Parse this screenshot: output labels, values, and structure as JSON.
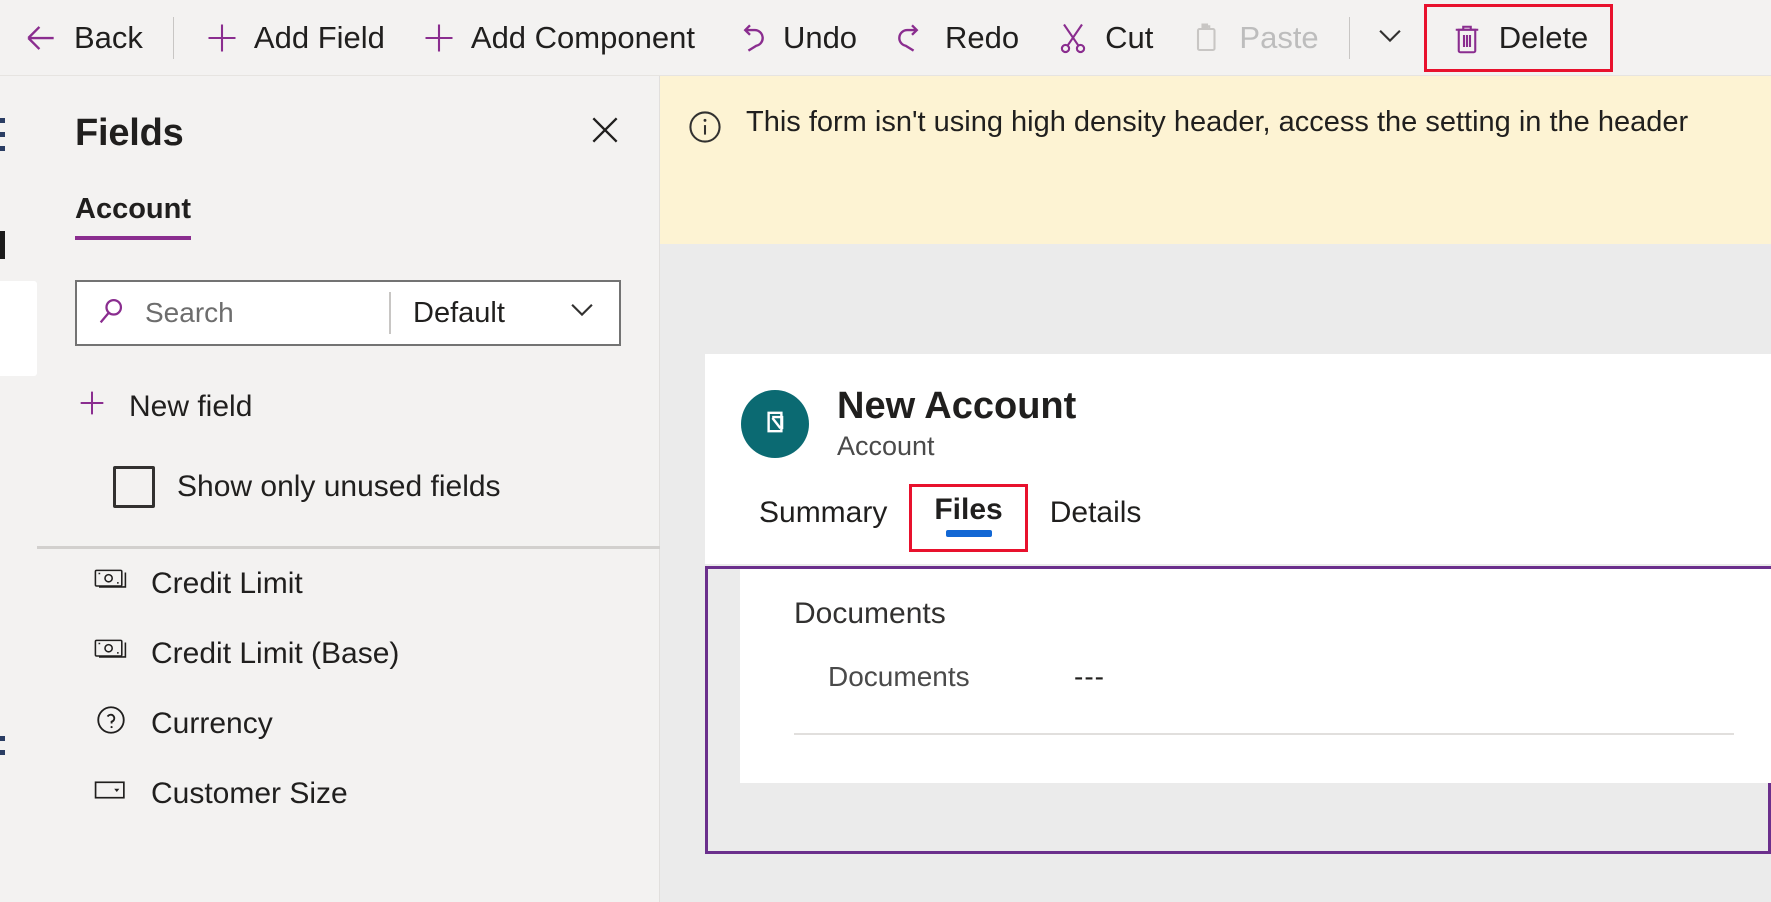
{
  "commandbar": {
    "buttons": [
      {
        "label": "Back",
        "icon": "arrow-left-icon",
        "disabled": false
      },
      {
        "label": "Add Field",
        "icon": "plus-icon",
        "disabled": false
      },
      {
        "label": "Add Component",
        "icon": "plus-icon",
        "disabled": false
      },
      {
        "label": "Undo",
        "icon": "undo-icon",
        "disabled": false
      },
      {
        "label": "Redo",
        "icon": "redo-icon",
        "disabled": false
      },
      {
        "label": "Cut",
        "icon": "scissors-icon",
        "disabled": false
      },
      {
        "label": "Paste",
        "icon": "clipboard-icon",
        "disabled": true
      },
      {
        "label": "Delete",
        "icon": "trash-icon",
        "disabled": false
      }
    ],
    "overflow_icon": "chevron-down-icon",
    "highlight_color": "#e8112d",
    "accent_color": "#8a2d8f"
  },
  "fields_panel": {
    "title": "Fields",
    "close_icon": "close-icon",
    "tab": "Account",
    "tab_underline_color": "#8a2d8f",
    "search": {
      "icon": "search-icon",
      "placeholder": "Search",
      "value": ""
    },
    "filter": {
      "selected": "Default",
      "icon": "chevron-down-icon"
    },
    "new_field": {
      "label": "New field",
      "icon": "plus-icon"
    },
    "checkbox": {
      "label": "Show only unused fields",
      "checked": false
    },
    "scroll_up_icon": "caret-up-icon",
    "items": [
      {
        "label": "Credit Limit",
        "icon": "currency-icon"
      },
      {
        "label": "Credit Limit (Base)",
        "icon": "currency-icon"
      },
      {
        "label": "Currency",
        "icon": "lookup-icon"
      },
      {
        "label": "Customer Size",
        "icon": "choice-icon"
      }
    ]
  },
  "canvas": {
    "notification": {
      "icon": "info-icon",
      "text": "This form isn't using high density header, access the setting in the header",
      "background": "#fdf3d3"
    },
    "form": {
      "avatar_icon": "account-entity-icon",
      "avatar_color": "#0b6a72",
      "title": "New Account",
      "subtitle": "Account",
      "tabs": [
        {
          "label": "Summary",
          "active": false,
          "highlighted": false
        },
        {
          "label": "Files",
          "active": true,
          "highlighted": true
        },
        {
          "label": "Details",
          "active": false,
          "highlighted": false
        }
      ],
      "active_tab_underline_color": "#1267d4",
      "selection_border_color": "#6b2f8c",
      "section": {
        "title": "Documents",
        "rows": [
          {
            "label": "Documents",
            "value": "---"
          }
        ]
      }
    }
  }
}
